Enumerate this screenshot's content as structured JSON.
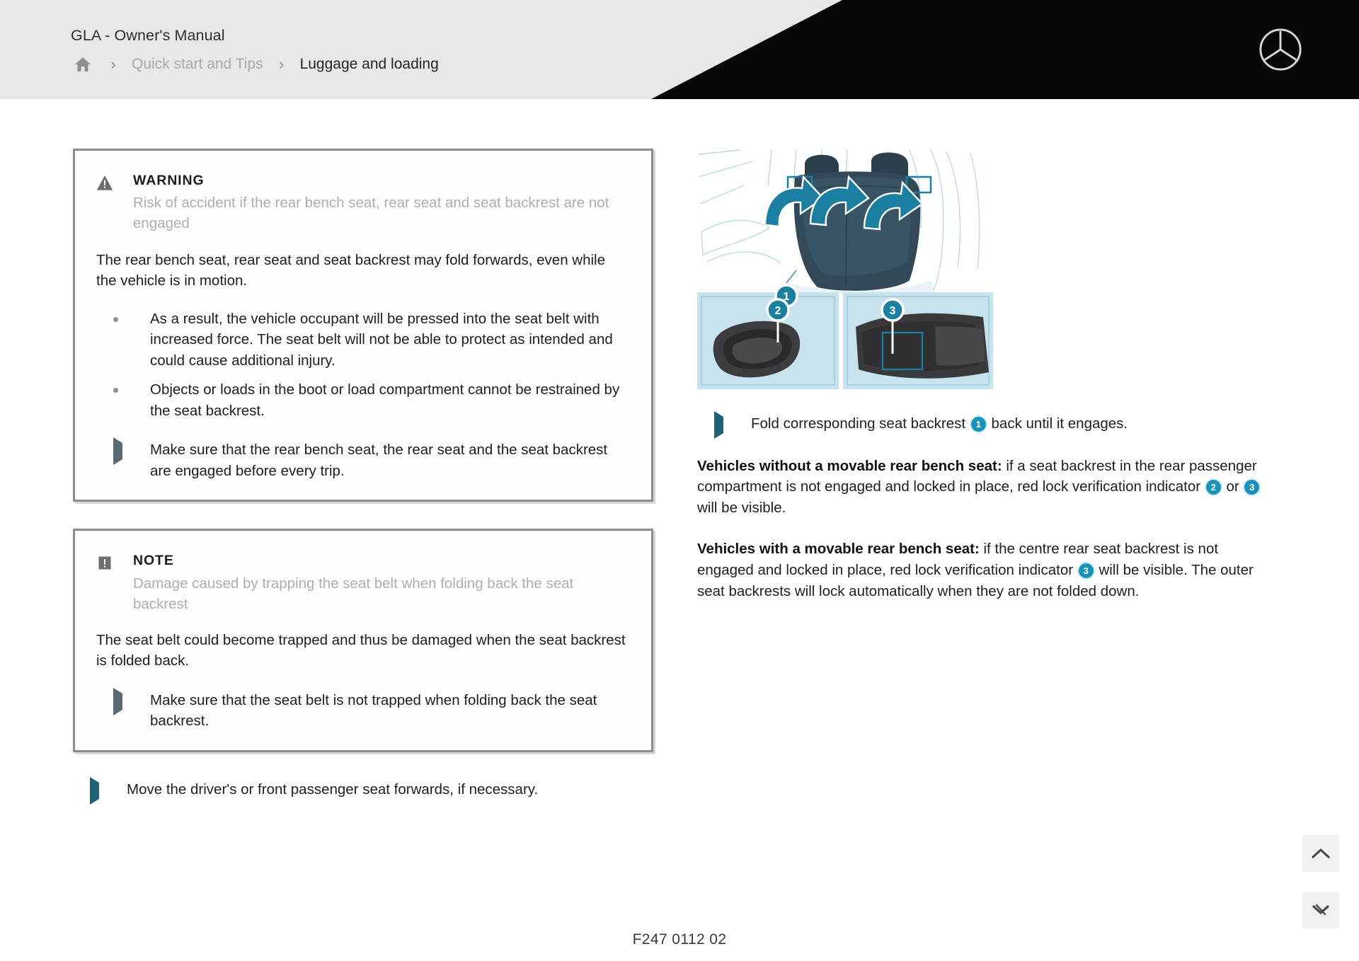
{
  "header": {
    "title": "GLA - Owner's Manual",
    "home_icon": "home-icon",
    "separator": "›",
    "breadcrumb": [
      {
        "label": "Quick start and Tips",
        "state": "muted"
      },
      {
        "label": "Luggage and loading",
        "state": "current"
      }
    ],
    "logo": "mercedes-star-logo",
    "accent_black": "#070707",
    "bar_bg": "#e8e8e8"
  },
  "warning_box": {
    "icon": "warning-triangle-icon",
    "title": "WARNING",
    "subtitle": "Risk of accident if the rear bench seat, rear seat and seat backrest are not engaged",
    "body": "The rear bench seat, rear seat and seat backrest may fold forwards, even while the vehicle is in motion.",
    "bullets": [
      "As a result, the vehicle occupant will be pressed into the seat belt with increased force. The seat belt will not be able to protect as intended and could cause additional injury.",
      "Objects or loads in the boot or load compartment cannot be restrained by the seat backrest."
    ],
    "action": "Make sure that the rear bench seat, the rear seat and the seat backrest are engaged before every trip."
  },
  "note_box": {
    "icon": "note-exclamation-icon",
    "title": "NOTE",
    "subtitle": "Damage caused by trapping the seat belt when folding back the seat backrest",
    "body": "The seat belt could become trapped and thus be damaged when the seat backrest is folded back.",
    "action": "Make sure that the seat belt is not trapped when folding back the seat backrest."
  },
  "left_standalone_action": "Move the driver's or front passenger seat forwards, if necessary.",
  "figure": {
    "name": "rear-seat-backrest-folding-illustration",
    "callouts": [
      "1",
      "2",
      "3"
    ],
    "arrow_count": 3,
    "accent_color": "#1a7fa0",
    "panel_bg": "#c6e3ee"
  },
  "right_column": {
    "action_pre": "Fold corresponding seat backrest",
    "action_badge": "1",
    "action_post": "back until it engages.",
    "paragraphs": [
      {
        "lead": "Vehicles without a movable rear bench seat:",
        "part1": " if a seat backrest in the rear passenger compartment is not engaged and locked in place, red lock verification indicator ",
        "badge1": "2",
        "mid": " or ",
        "badge2": "3",
        "part2": " will be visible."
      },
      {
        "lead": "Vehicles with a movable rear bench seat:",
        "part1": " if the centre rear seat backrest is not engaged and locked in place, red lock verification indicator ",
        "badge1": "3",
        "part2": " will be visible. The outer seat backrests will lock automatically when they are not folded down."
      }
    ]
  },
  "side_buttons": [
    {
      "name": "scroll-to-top-button",
      "icon": "chevron-up-icon"
    },
    {
      "name": "collapse-button",
      "icon": "chevron-down-icon"
    }
  ],
  "footer": {
    "code": "F247 0112 02"
  },
  "colors": {
    "accent_teal": "#1a93b8",
    "box_border": "#8d8d8d",
    "muted_text": "#aeaeae",
    "body_text": "#1e1e1e"
  }
}
